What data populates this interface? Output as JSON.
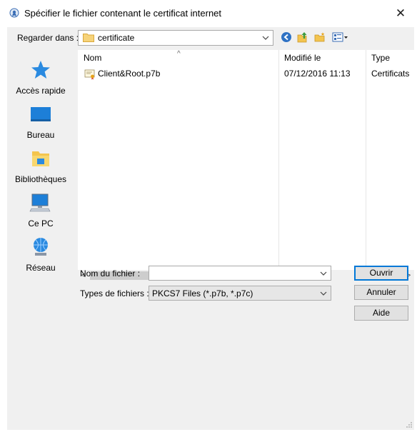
{
  "window": {
    "title": "Spécifier le fichier contenant le certificat internet",
    "close_glyph": "✕"
  },
  "toolbar": {
    "look_in_label": "Regarder dans :",
    "look_in_value": "certificate",
    "back_icon": "back-arrow-icon",
    "up_icon": "up-folder-icon",
    "new_folder_icon": "new-folder-icon",
    "view_icon": "view-menu-icon"
  },
  "places": [
    {
      "label": "Accès rapide",
      "icon": "star-icon"
    },
    {
      "label": "Bureau",
      "icon": "desktop-icon"
    },
    {
      "label": "Bibliothèques",
      "icon": "library-icon"
    },
    {
      "label": "Ce PC",
      "icon": "computer-icon"
    },
    {
      "label": "Réseau",
      "icon": "network-icon"
    }
  ],
  "file_list": {
    "columns": [
      "Nom",
      "Modifié le",
      "Type"
    ],
    "rows": [
      {
        "name": "Client&Root.p7b",
        "modified": "07/12/2016 11:13",
        "type": "Certificats"
      }
    ]
  },
  "form": {
    "filename_label": "Nom du fichier :",
    "filename_value": "",
    "filetype_label": "Types de fichiers :",
    "filetype_value": "PKCS7 Files (*.p7b, *.p7c)"
  },
  "buttons": {
    "open": "Ouvrir",
    "cancel": "Annuler",
    "help": "Aide"
  },
  "colors": {
    "accent": "#0078d7",
    "chrome": "#f0f0f0"
  }
}
